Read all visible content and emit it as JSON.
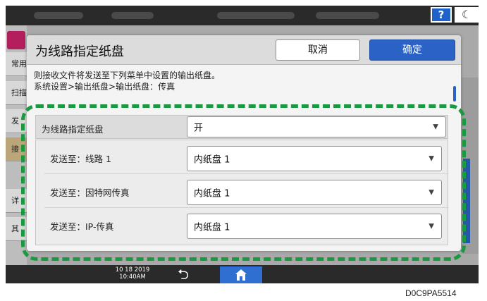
{
  "header_bar": {
    "help_label": "?",
    "sleep_icon": "moon-icon"
  },
  "background_tabs": [
    "常用",
    "扫描",
    "发",
    "接",
    "详",
    "其"
  ],
  "dialog": {
    "title": "为线路指定纸盘",
    "cancel_label": "取消",
    "ok_label": "确定",
    "description_line1": "则接收文件将发送至下列菜单中设置的输出纸盘。",
    "description_line2": "系统设置>输出纸盘>输出纸盘：传真",
    "main_setting": {
      "label": "为线路指定纸盘",
      "value": "开"
    },
    "rows": [
      {
        "label": "发送至：线路 1",
        "value": "内纸盘 1"
      },
      {
        "label": "发送至：因特网传真",
        "value": "内纸盘 1"
      },
      {
        "label": "发送至：IP-传真",
        "value": "内纸盘 1"
      }
    ]
  },
  "bottom_bar": {
    "date": "10 18 2019",
    "time": "10:40AM",
    "back_icon": "back-arrow-icon",
    "home_icon": "home-icon"
  },
  "figure_id": "D0C9PA5514",
  "colors": {
    "accent": "#2b62c6",
    "highlight": "#1a9a40",
    "bar": "#2a2a2a"
  }
}
